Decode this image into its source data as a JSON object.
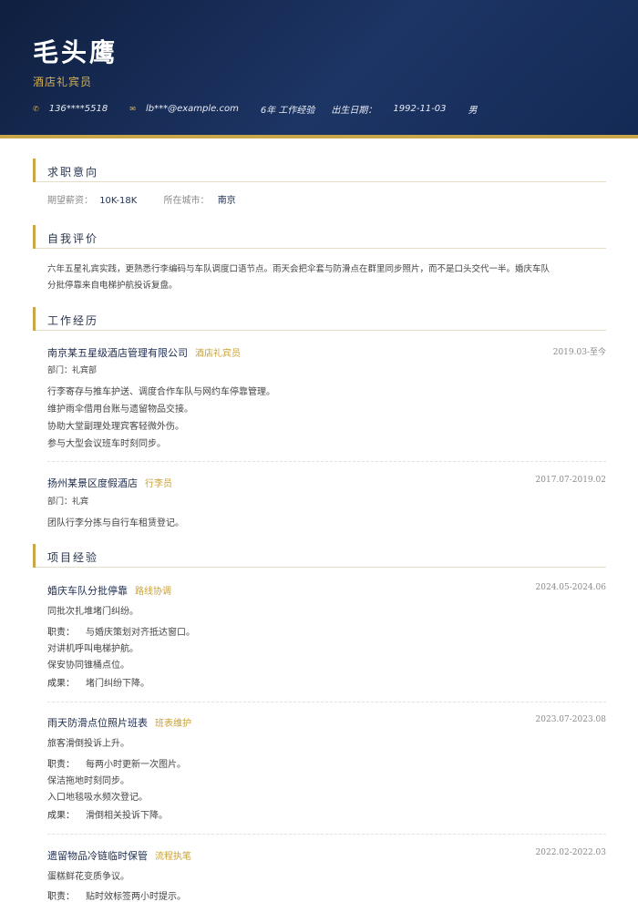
{
  "header": {
    "name": "毛头鹰",
    "role": "酒店礼宾员",
    "phone": "136****5518",
    "email": "lb***@example.com",
    "experience": "6年 工作经验",
    "birth_label": "出生日期：",
    "birth": "1992-11-03",
    "gender": "男",
    "phone_icon": "phone-icon",
    "mail_icon": "mail-icon",
    "accent": "#c9a64a",
    "header_bg": "#1d3565"
  },
  "intent": {
    "title": "求职意向",
    "salary_label": "期望薪资：",
    "salary": "10K-18K",
    "city_label": "所在城市：",
    "city": "南京"
  },
  "summary": {
    "title": "自我评价",
    "line1": "六年五星礼宾实践，更熟悉行李编码与车队调度口语节点。雨天会把伞套与防滑点在群里同步照片，而不是口头交代一半。婚庆车队",
    "line2": "分批停靠来自电梯护航投诉复盘。"
  },
  "work": {
    "title": "工作经历",
    "items": [
      {
        "company": "南京某五星级酒店管理有限公司",
        "role": "酒店礼宾员",
        "date": "2019.03-至今",
        "dept": "部门：礼宾部",
        "lines": [
          "行李寄存与推车护送、调度合作车队与网约车停靠管理。",
          "维护雨伞借用台账与遗留物品交接。",
          "协助大堂副理处理宾客轻微外伤。",
          "参与大型会议班车时刻同步。"
        ]
      },
      {
        "company": "扬州某景区度假酒店",
        "role": "行李员",
        "date": "2017.07-2019.02",
        "dept": "部门：礼宾",
        "lines": [
          "团队行李分拣与自行车租赁登记。"
        ]
      }
    ]
  },
  "projects": {
    "title": "项目经验",
    "duty_label": "职责：",
    "result_label": "成果：",
    "items": [
      {
        "name": "婚庆车队分批停靠",
        "tag": "路线协调",
        "date": "2024.05-2024.06",
        "intro": "同批次扎堆堵门纠纷。",
        "duty": "与婚庆策划对齐抵达窗口。",
        "extra": [
          "对讲机呼叫电梯护航。",
          "保安协同锥桶点位。"
        ],
        "result": "堵门纠纷下降。"
      },
      {
        "name": "雨天防滑点位照片班表",
        "tag": "班表维护",
        "date": "2023.07-2023.08",
        "intro": "旅客滑倒投诉上升。",
        "duty": "每两小时更新一次图片。",
        "extra": [
          "保洁拖地时刻同步。",
          "入口地毯吸水频次登记。"
        ],
        "result": "滑倒相关投诉下降。"
      },
      {
        "name": "遗留物品冷链临时保管",
        "tag": "流程执笔",
        "date": "2022.02-2022.03",
        "intro": "蛋糕鲜花变质争议。",
        "duty": "贴时效标签两小时提示。"
      }
    ]
  }
}
